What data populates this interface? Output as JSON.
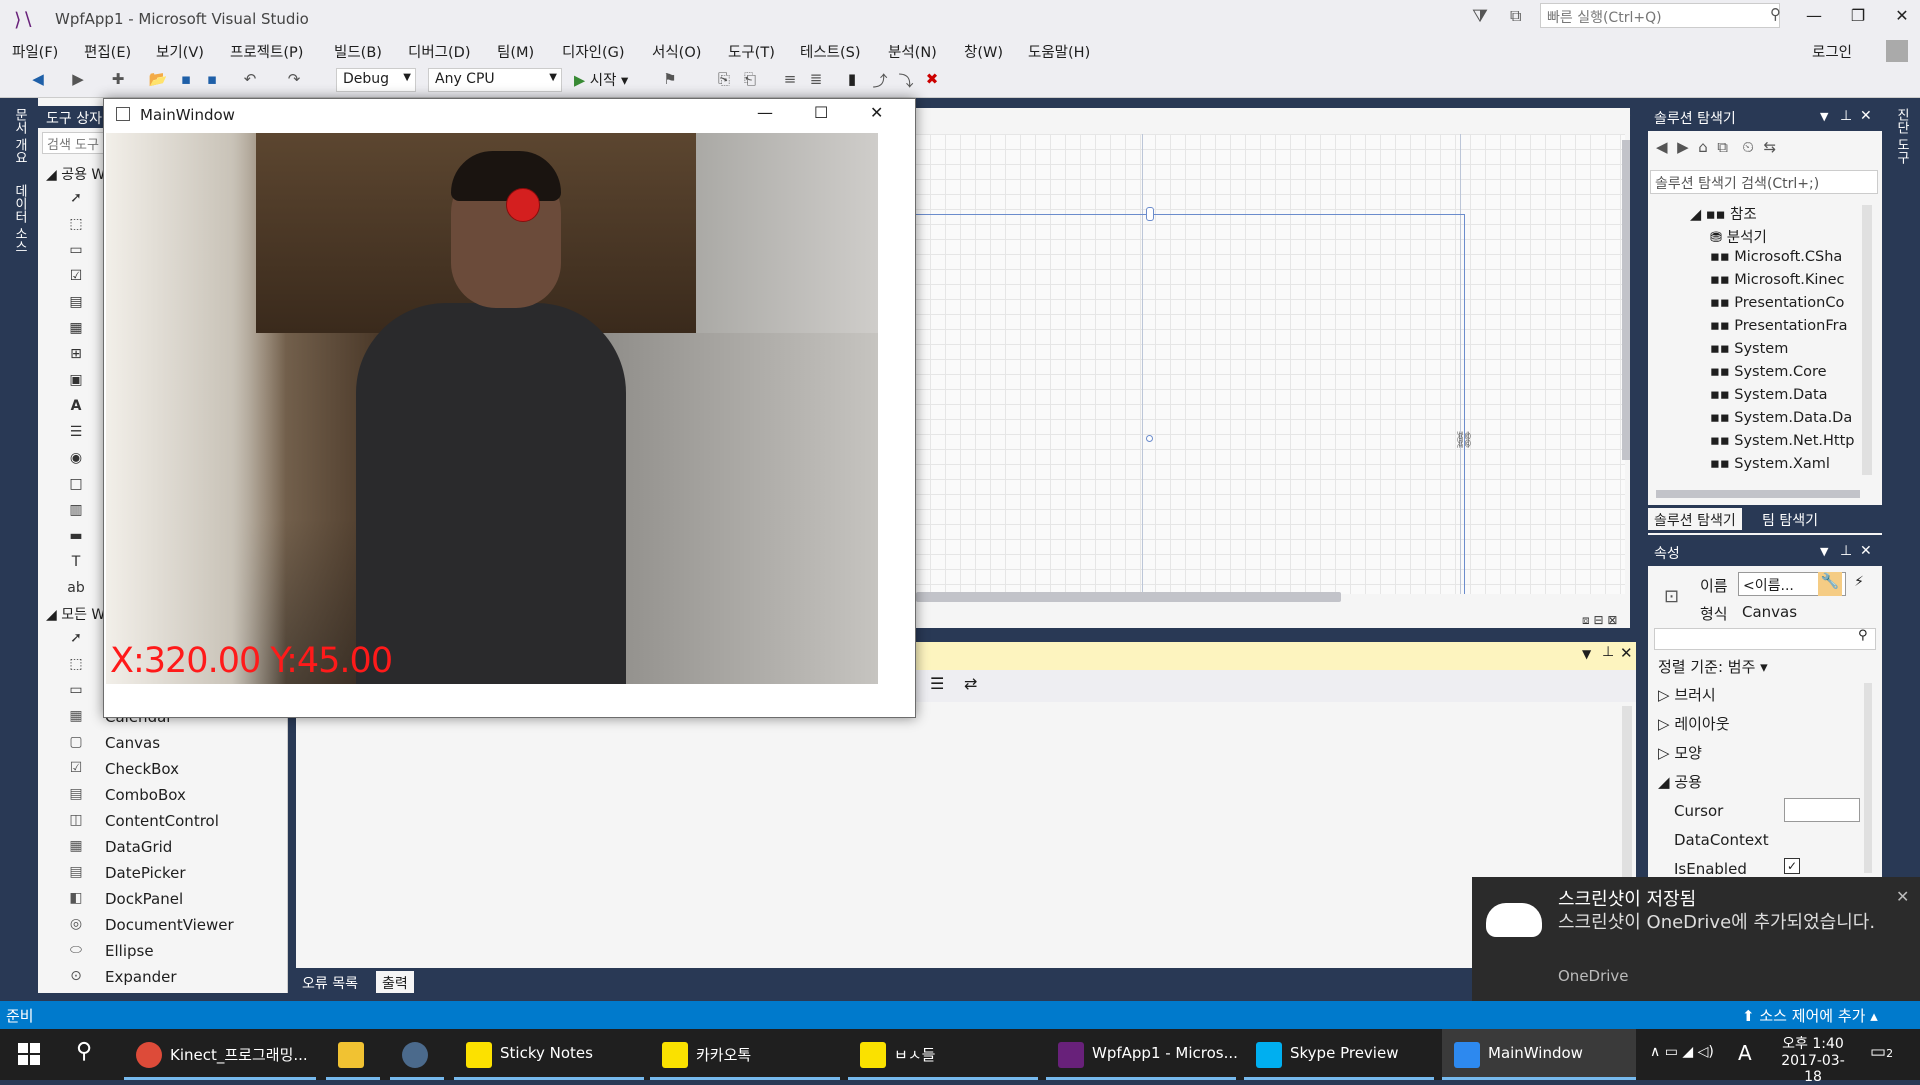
{
  "titlebar": {
    "title": "WpfApp1 - Microsoft Visual Studio",
    "quick_launch": "빠른 실행(Ctrl+Q)",
    "login": "로그인"
  },
  "menu": [
    "파일(F)",
    "편집(E)",
    "보기(V)",
    "프로젝트(P)",
    "빌드(B)",
    "디버그(D)",
    "팀(M)",
    "디자인(G)",
    "서식(O)",
    "도구(T)",
    "테스트(S)",
    "분석(N)",
    "창(W)",
    "도움말(H)"
  ],
  "toolbar": {
    "config": "Debug",
    "platform": "Any CPU",
    "start": "시작"
  },
  "left_tabs": [
    "문서 개요",
    "데이터 소스"
  ],
  "right_tabs": [
    "진단 도구"
  ],
  "toolbox": {
    "header": "도구 상자",
    "search": "검색 도구 상자",
    "group_common": "공용 W",
    "group_all": "모든 W",
    "items": [
      "Calendar",
      "Canvas",
      "CheckBox",
      "ComboBox",
      "ContentControl",
      "DataGrid",
      "DatePicker",
      "DockPanel",
      "DocumentViewer",
      "Ellipse",
      "Expander"
    ]
  },
  "mainwindow": {
    "title": "MainWindow",
    "coord_text": "X:320.00 Y:45.00"
  },
  "solution_explorer": {
    "header": "솔루션 탐색기",
    "search": "솔루션 탐색기 검색(Ctrl+;)",
    "references_node": "참조",
    "references": [
      "분석기",
      "Microsoft.CSha",
      "Microsoft.Kinec",
      "PresentationCo",
      "PresentationFra",
      "System",
      "System.Core",
      "System.Data",
      "System.Data.Da",
      "System.Net.Http",
      "System.Xaml"
    ],
    "tabs": [
      "솔루션 탐색기",
      "팀 탐색기"
    ]
  },
  "properties": {
    "header": "속성",
    "name_label": "이름",
    "name_value": "<이름...",
    "type_label": "형식",
    "type_value": "Canvas",
    "sort_label": "정렬 기준: 범주",
    "categories": [
      "브러시",
      "레이아웃",
      "모양",
      "공용"
    ],
    "props": [
      "Cursor",
      "DataContext",
      "IsEnabled"
    ]
  },
  "output": {
    "tabs": [
      "오류 목록",
      "출력"
    ]
  },
  "statusbar": {
    "left": "준비",
    "right": "소스 제어에 추가"
  },
  "toast": {
    "title": "스크린샷이 저장됨",
    "body": "스크린샷이 OneDrive에 추가되었습니다.",
    "source": "OneDrive"
  },
  "taskbar": {
    "items": [
      {
        "label": "Kinect_프로그래밍...",
        "color": "#dd4b39"
      },
      {
        "label": "",
        "color": "#f1c232"
      },
      {
        "label": "",
        "color": "#1b2838"
      },
      {
        "label": "Sticky Notes",
        "color": "#fce100"
      },
      {
        "label": "카카오톡",
        "color": "#fae100"
      },
      {
        "label": "ㅂㅅ들",
        "color": "#fae100"
      },
      {
        "label": "WpfApp1 - Micros...",
        "color": "#68217a"
      },
      {
        "label": "Skype Preview",
        "color": "#00aff0"
      },
      {
        "label": "MainWindow",
        "color": "#2d89ef"
      }
    ],
    "time": "오후 1:40",
    "date": "2017-03-18",
    "ime": "A",
    "notifications": "2"
  }
}
